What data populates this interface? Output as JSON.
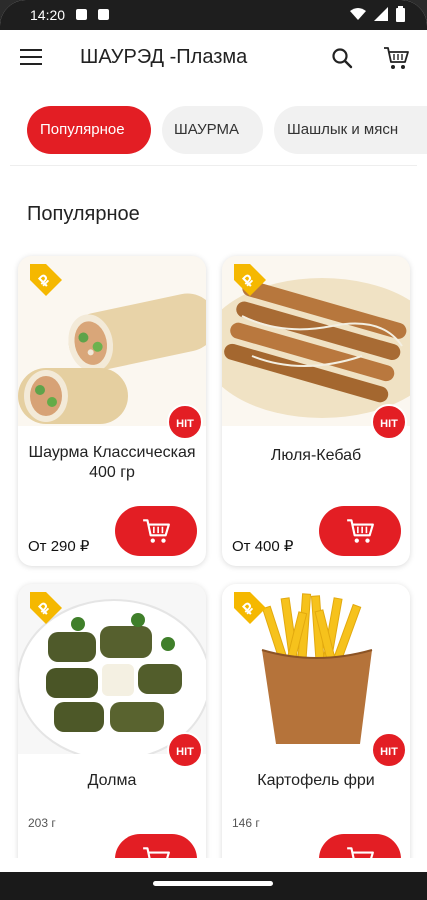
{
  "status_bar": {
    "time": "14:20"
  },
  "app_bar": {
    "title": "ШАУРЭД -Плазма"
  },
  "tabs": [
    {
      "label": "Популярное",
      "active": true
    },
    {
      "label": "ШАУРМА",
      "active": false
    },
    {
      "label": "Шашлык и мясн",
      "active": false
    }
  ],
  "section": {
    "title": "Популярное"
  },
  "products": [
    {
      "name": "Шаурма Классическая 400 гр",
      "price": "От 290 ₽",
      "weight": "",
      "badge": "HIT",
      "image": "shawarma-roll"
    },
    {
      "name": "Люля-Кебаб",
      "price": "От 400 ₽",
      "weight": "",
      "badge": "HIT",
      "image": "lula-kebab"
    },
    {
      "name": "Долма",
      "price": "",
      "weight": "203 г",
      "badge": "HIT",
      "image": "dolma"
    },
    {
      "name": "Картофель фри",
      "price": "",
      "weight": "146 г",
      "badge": "HIT",
      "image": "french-fries"
    }
  ],
  "colors": {
    "accent": "#e31e24",
    "tag": "#f5b800"
  }
}
